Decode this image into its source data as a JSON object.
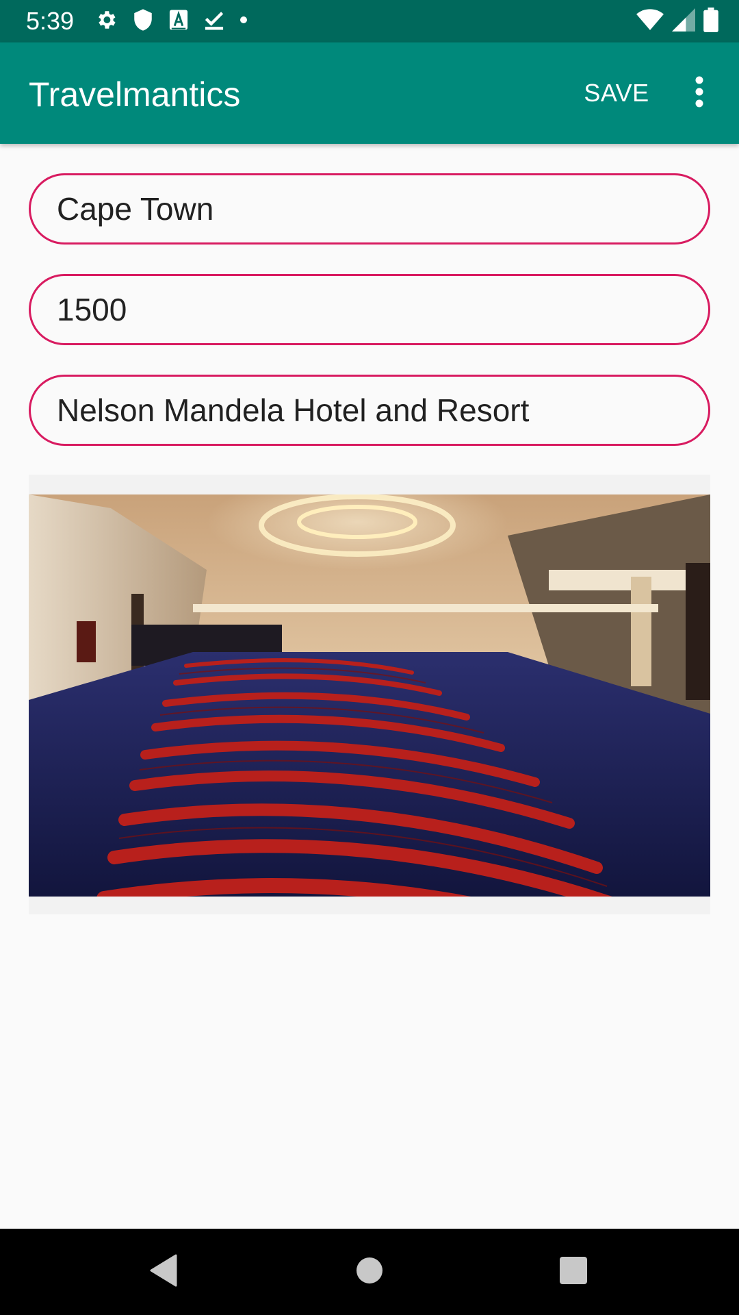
{
  "status_bar": {
    "time": "5:39",
    "left_icons": [
      "gear-icon",
      "shield-icon",
      "a-box-icon",
      "check-download-icon",
      "dot-icon"
    ],
    "right_icons": [
      "wifi-icon",
      "cell-signal-icon",
      "battery-icon"
    ]
  },
  "app_bar": {
    "title": "Travelmantics",
    "save_label": "SAVE",
    "overflow_icon": "more-vert-icon",
    "color": "#00897b",
    "status_color": "#00695c"
  },
  "form": {
    "city_value": "Cape Town",
    "price_value": "1500",
    "description_value": "Nelson Mandela Hotel and Resort",
    "border_color": "#d81b60"
  },
  "image": {
    "icon": "deal-photo"
  },
  "nav_bar": {
    "icons": [
      "back-icon",
      "home-icon",
      "recents-icon"
    ]
  }
}
